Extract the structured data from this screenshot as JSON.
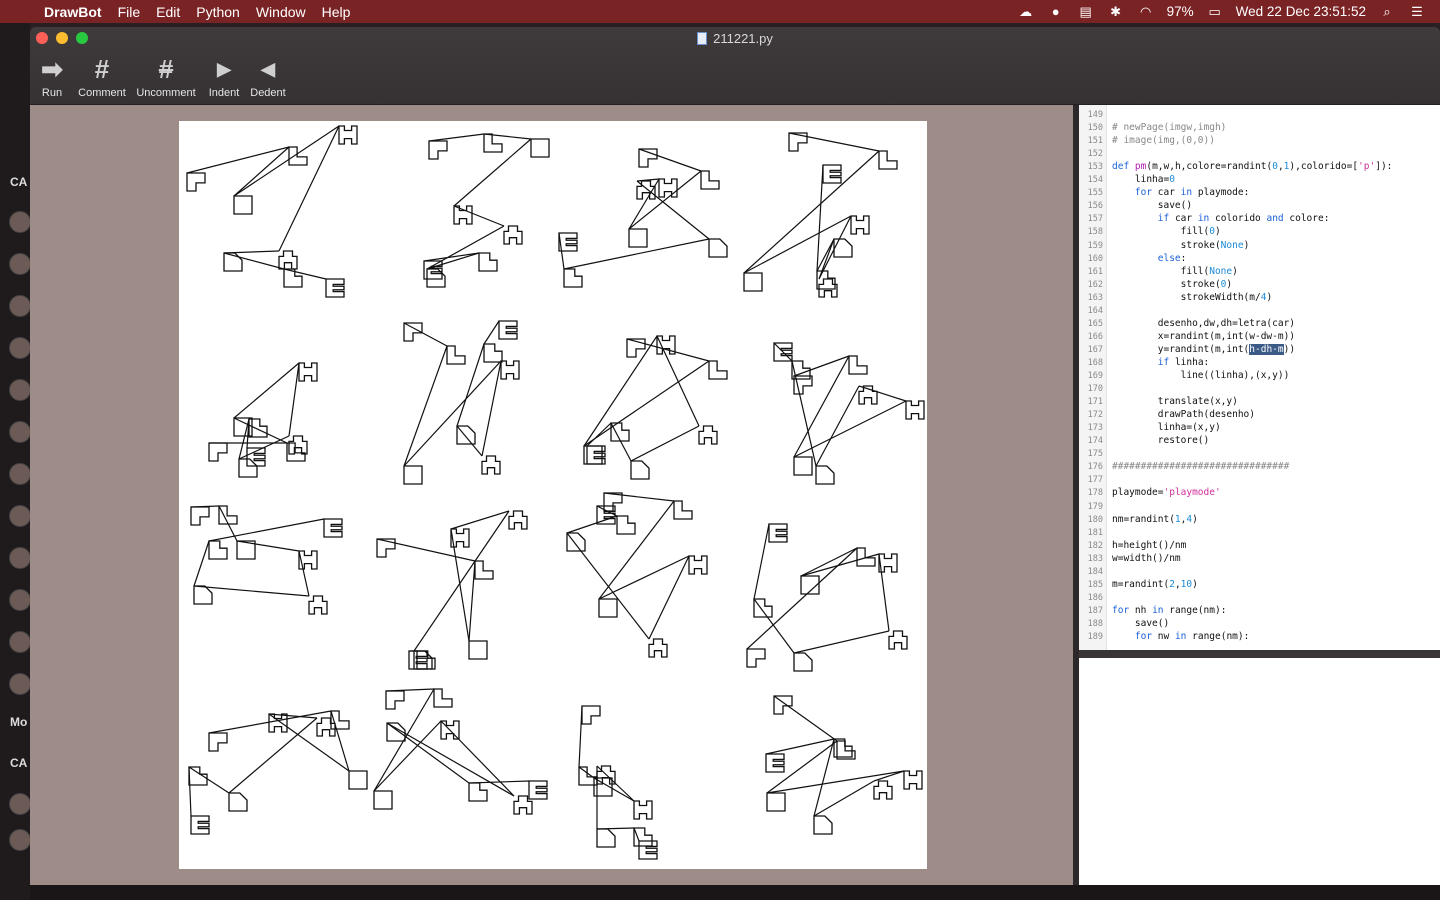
{
  "menubar": {
    "app": "DrawBot",
    "menus": [
      "File",
      "Edit",
      "Python",
      "Window",
      "Help"
    ],
    "battery": "97%",
    "datetime": "Wed 22 Dec  23:51:52"
  },
  "sidebar_bg": {
    "labels": [
      "CA",
      "Mo",
      "CA"
    ]
  },
  "window": {
    "title": "211221.py",
    "toolbar": [
      {
        "label": "Run",
        "icon": "play-arrow-icon",
        "glyph": "➡"
      },
      {
        "label": "Comment",
        "icon": "hash-icon",
        "glyph": "#"
      },
      {
        "label": "Uncomment",
        "icon": "hash-crossed-icon",
        "glyph": "#"
      },
      {
        "label": "Indent",
        "icon": "triangle-right-icon",
        "glyph": "▶"
      },
      {
        "label": "Dedent",
        "icon": "triangle-left-icon",
        "glyph": "◀"
      }
    ]
  },
  "editor": {
    "lines": [
      {
        "n": "149",
        "t": ""
      },
      {
        "n": "150",
        "t": "# newPage(imgw,imgh)"
      },
      {
        "n": "151",
        "t": "# image(img,(0,0))"
      },
      {
        "n": "152",
        "t": ""
      },
      {
        "n": "153",
        "t": "def pm(m,w,h,colore=randint(0,1),colorido=['p']):"
      },
      {
        "n": "154",
        "t": "    linha=0"
      },
      {
        "n": "155",
        "t": "    for car in playmode:"
      },
      {
        "n": "156",
        "t": "        save()"
      },
      {
        "n": "157",
        "t": "        if car in colorido and colore:"
      },
      {
        "n": "158",
        "t": "            fill(0)"
      },
      {
        "n": "159",
        "t": "            stroke(None)"
      },
      {
        "n": "160",
        "t": "        else:"
      },
      {
        "n": "161",
        "t": "            fill(None)"
      },
      {
        "n": "162",
        "t": "            stroke(0)"
      },
      {
        "n": "163",
        "t": "            strokeWidth(m/4)"
      },
      {
        "n": "164",
        "t": ""
      },
      {
        "n": "165",
        "t": "        desenho,dw,dh=letra(car)"
      },
      {
        "n": "166",
        "t": "        x=randint(m,int(w-dw-m))"
      },
      {
        "n": "167",
        "t": "        y=randint(m,int(h-dh-m))"
      },
      {
        "n": "168",
        "t": "        if linha:"
      },
      {
        "n": "169",
        "t": "            line((linha),(x,y))"
      },
      {
        "n": "170",
        "t": ""
      },
      {
        "n": "171",
        "t": "        translate(x,y)"
      },
      {
        "n": "172",
        "t": "        drawPath(desenho)"
      },
      {
        "n": "173",
        "t": "        linha=(x,y)"
      },
      {
        "n": "174",
        "t": "        restore()"
      },
      {
        "n": "175",
        "t": ""
      },
      {
        "n": "176",
        "t": "###############################"
      },
      {
        "n": "177",
        "t": ""
      },
      {
        "n": "178",
        "t": "playmode='playmode'"
      },
      {
        "n": "179",
        "t": ""
      },
      {
        "n": "180",
        "t": "nm=randint(1,4)"
      },
      {
        "n": "181",
        "t": ""
      },
      {
        "n": "182",
        "t": "h=height()/nm"
      },
      {
        "n": "183",
        "t": "w=width()/nm"
      },
      {
        "n": "184",
        "t": ""
      },
      {
        "n": "185",
        "t": "m=randint(2,10)"
      },
      {
        "n": "186",
        "t": ""
      },
      {
        "n": "187",
        "t": "for nh in range(nm):"
      },
      {
        "n": "188",
        "t": "    save()"
      },
      {
        "n": "189",
        "t": "    for nw in range(nm):"
      }
    ]
  }
}
